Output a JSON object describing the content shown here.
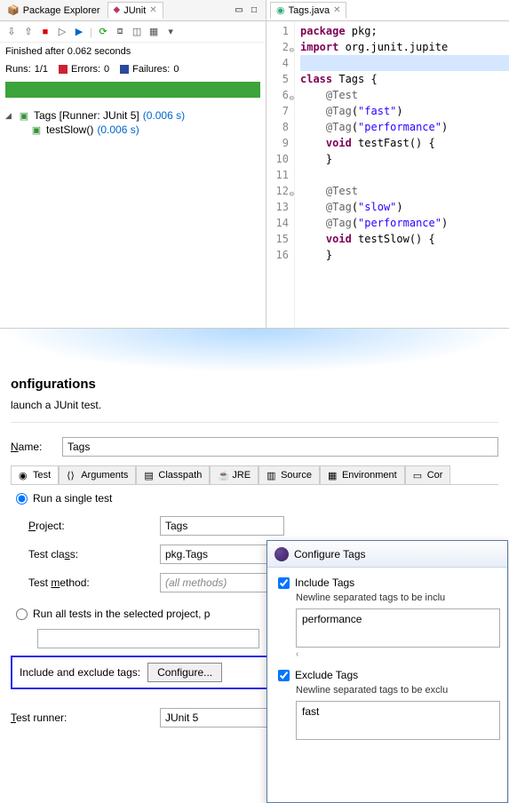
{
  "leftPanel": {
    "tabs": {
      "pkgExplorer": "Package Explorer",
      "junit": "JUnit"
    },
    "status": "Finished after 0.062 seconds",
    "stats": {
      "runsLabel": "Runs:",
      "runs": "1/1",
      "errorsLabel": "Errors:",
      "errors": "0",
      "failuresLabel": "Failures:",
      "failures": "0"
    },
    "tree": {
      "root": "Tags [Runner: JUnit 5]",
      "rootTime": "(0.006 s)",
      "child": "testSlow()",
      "childTime": "(0.006 s)"
    }
  },
  "editor": {
    "tab": "Tags.java",
    "lines": [
      {
        "n": "1",
        "html": "<span class='kw'>package</span> pkg;"
      },
      {
        "n": "2",
        "html": "<span class='kw'>import</span> org.junit.jupite",
        "fold": true
      },
      {
        "n": "4",
        "html": "",
        "hl": true
      },
      {
        "n": "5",
        "html": "<span class='kw'>class</span> Tags {"
      },
      {
        "n": "6",
        "html": "    <span class='ann'>@Test</span>",
        "fold": true
      },
      {
        "n": "7",
        "html": "    <span class='ann'>@Tag</span>(<span class='str'>\"fast\"</span>)"
      },
      {
        "n": "8",
        "html": "    <span class='ann'>@Tag</span>(<span class='str'>\"performance\"</span>)"
      },
      {
        "n": "9",
        "html": "    <span class='kw'>void</span> testFast() {"
      },
      {
        "n": "10",
        "html": "    }"
      },
      {
        "n": "11",
        "html": ""
      },
      {
        "n": "12",
        "html": "    <span class='ann'>@Test</span>",
        "fold": true
      },
      {
        "n": "13",
        "html": "    <span class='ann'>@Tag</span>(<span class='str'>\"slow\"</span>)"
      },
      {
        "n": "14",
        "html": "    <span class='ann'>@Tag</span>(<span class='str'>\"performance\"</span>)"
      },
      {
        "n": "15",
        "html": "    <span class='kw'>void</span> testSlow() {"
      },
      {
        "n": "16",
        "html": "    }"
      }
    ]
  },
  "config": {
    "title": "onfigurations",
    "subtitle": "launch a JUnit test.",
    "nameLabel": "Name:",
    "nameValue": "Tags",
    "tabs": [
      "Test",
      "Arguments",
      "Classpath",
      "JRE",
      "Source",
      "Environment",
      "Cor"
    ],
    "radio1": "Run a single test",
    "projectLabel": "Project:",
    "projectValue": "Tags",
    "classLabel": "Test class:",
    "classValue": "pkg.Tags",
    "methodLabel": "Test method:",
    "methodPlaceholder": "(all methods)",
    "radio2": "Run all tests in the selected project, p",
    "tagsLabel": "Include and exclude tags:",
    "configBtn": "Configure...",
    "runnerLabel": "Test runner:",
    "runnerValue": "JUnit 5"
  },
  "dialog": {
    "title": "Configure Tags",
    "includeCheck": "Include Tags",
    "includeSub": "Newline separated tags to be inclu",
    "includeValue": "performance",
    "excludeCheck": "Exclude Tags",
    "excludeSub": "Newline separated tags to be exclu",
    "excludeValue": "fast"
  }
}
